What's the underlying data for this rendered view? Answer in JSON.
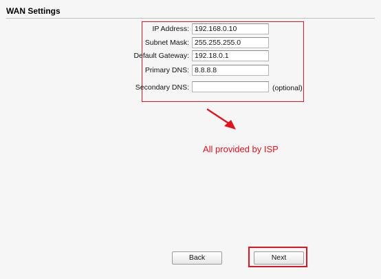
{
  "header": {
    "title": "WAN Settings"
  },
  "form": {
    "ip_address": {
      "label": "IP Address:",
      "value": "192.168.0.10"
    },
    "subnet_mask": {
      "label": "Subnet Mask:",
      "value": "255.255.255.0"
    },
    "default_gateway": {
      "label": "Default Gateway:",
      "value": "192.18.0.1"
    },
    "primary_dns": {
      "label": "Primary DNS:",
      "value": "8.8.8.8"
    },
    "secondary_dns": {
      "label": "Secondary DNS:",
      "value": "",
      "note": "(optional)"
    }
  },
  "annotation": {
    "text": "All provided by ISP",
    "color": "#e0141e"
  },
  "buttons": {
    "back": "Back",
    "next": "Next"
  }
}
